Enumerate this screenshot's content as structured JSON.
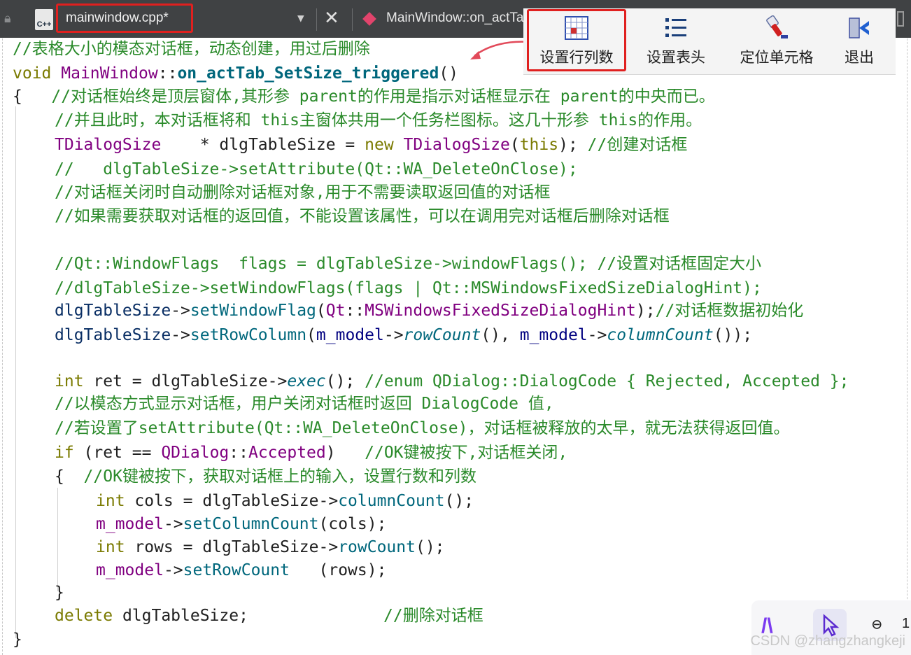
{
  "tabbar": {
    "file_icon_text": "C++",
    "filename": "mainwindow.cpp*",
    "function_label": "MainWindow::on_actTa"
  },
  "toolbar": {
    "buttons": [
      {
        "label": "设置行列数",
        "icon": "grid-table-icon"
      },
      {
        "label": "设置表头",
        "icon": "list-icon"
      },
      {
        "label": "定位单元格",
        "icon": "flashlight-icon"
      },
      {
        "label": "退出",
        "icon": "exit-door-icon"
      }
    ]
  },
  "code": {
    "l1": "//表格大小的模态对话框，动态创建，用过后删除",
    "l2_kw": "void ",
    "l2_cls": "MainWindow",
    "l2_sep": "::",
    "l2_fn": "on_actTab_SetSize_triggered",
    "l2_end": "()",
    "l3_brace": "{",
    "l3_cmt": "   //对话框始终是顶层窗体,其形参 parent的作用是指示对话框显示在 parent的中央而已。",
    "l4": "//并且此时，本对话框将和 this主窗体共用一个任务栏图标。这几十形参 this的作用。",
    "l5_type": "TDialogSize",
    "l5_a": "    * dlgTableSize = ",
    "l5_new": "new ",
    "l5_type2": "TDialogSize",
    "l5_b": "(",
    "l5_this": "this",
    "l5_c": "); ",
    "l5_cmt": "//创建对话框",
    "l6": "//   dlgTableSize->setAttribute(Qt::WA_DeleteOnClose);",
    "l7": "//对话框关闭时自动删除对话框对象,用于不需要读取返回值的对话框",
    "l8": "//如果需要获取对话框的返回值，不能设置该属性，可以在调用完对话框后删除对话框",
    "l9": "//Qt::WindowFlags  flags = dlgTableSize->windowFlags(); //设置对话框固定大小",
    "l10": "//dlgTableSize->setWindowFlags(flags | Qt::MSWindowsFixedSizeDialogHint);",
    "l11_var": "dlgTableSize",
    "l11_arrow": "->",
    "l11_fn": "setWindowFlag",
    "l11_p": "(",
    "l11_ns": "Qt",
    "l11_sep": "::",
    "l11_enum": "MSWindowsFixedSizeDialogHint",
    "l11_end": ");",
    "l11_cmt": "//对话框数据初始化",
    "l12_var": "dlgTableSize",
    "l12_arrow": "->",
    "l12_fn": "setRowColumn",
    "l12_p": "(",
    "l12_m": "m_model",
    "l12_arrow2": "->",
    "l12_it": "rowCount",
    "l12_mid": "(), ",
    "l12_m2": "m_model",
    "l12_arrow3": "->",
    "l12_it2": "columnCount",
    "l12_end": "());",
    "l13_kw": "int ",
    "l13_a": "ret = dlgTableSize->",
    "l13_it": "exec",
    "l13_b": "(); ",
    "l13_cmt": "//enum QDialog::DialogCode { Rejected, Accepted };",
    "l14": "//以模态方式显示对话框，用户关闭对话框时返回 DialogCode 值,",
    "l15": "//若设置了setAttribute(Qt::WA_DeleteOnClose)，对话框被释放的太早，就无法获得返回值。",
    "l16_kw": "if ",
    "l16_a": "(ret == ",
    "l16_cls": "QDialog",
    "l16_sep": "::",
    "l16_enum": "Accepted",
    "l16_b": ")   ",
    "l16_cmt": "//OK键被按下,对话框关闭,",
    "l17_brace": "{",
    "l17_cmt": "  //OK键被按下，获取对话框上的输入，设置行数和列数",
    "l18_kw": "int ",
    "l18_a": "cols = dlgTableSize->",
    "l18_fn": "columnCount",
    "l18_b": "();",
    "l19_m": "m_model",
    "l19_arrow": "->",
    "l19_fn": "setColumnCount",
    "l19_b": "(cols);",
    "l20_kw": "int ",
    "l20_a": "rows = dlgTableSize->",
    "l20_fn": "rowCount",
    "l20_b": "();",
    "l21_m": "m_model",
    "l21_arrow": "->",
    "l21_fn": "setRowCount",
    "l21_b": "   (rows);",
    "l22": "}",
    "l23_kw": "delete ",
    "l23_a": "dlgTableSize;",
    "l23_cmt": "//删除对话框",
    "l24": "}"
  },
  "overlay": {
    "logo_text": "/\\",
    "zoom_icon": "⊖",
    "zoom_value": "1",
    "watermark": "CSDN @zhangzhangkeji"
  },
  "colors": {
    "comment": "#2a8a2a",
    "keyword": "#7a7a00",
    "type": "#800080",
    "function": "#00677c",
    "highlight_box": "#e0201f"
  }
}
